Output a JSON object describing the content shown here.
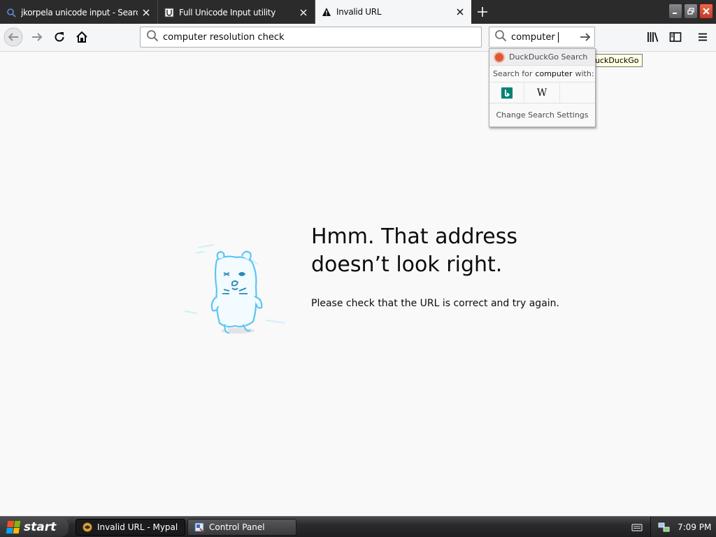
{
  "tabs": [
    {
      "label": "jkorpela unicode input - Search",
      "icon": "search-icon",
      "active": false
    },
    {
      "label": "Full Unicode Input utility",
      "icon": "unicode-icon",
      "active": false
    },
    {
      "label": "Invalid URL",
      "icon": "warning-icon",
      "active": true
    }
  ],
  "toolbar": {
    "url": "computer resolution check",
    "search_text": "computer"
  },
  "search_popup": {
    "engine_name": "DuckDuckGo Search",
    "search_for_prefix": "Search for",
    "search_term": "computer",
    "search_for_suffix": "with:",
    "engines": [
      "bing-icon",
      "wikipedia-icon",
      ""
    ],
    "settings_label": "Change Search Settings",
    "tooltip": "uckDuckGo"
  },
  "error": {
    "title": "Hmm. That address doesn’t look right.",
    "description": "Please check that the URL is correct and try again."
  },
  "taskbar": {
    "start_label": "start",
    "tasks": [
      {
        "label": "Invalid URL - Mypal",
        "pressed": true
      },
      {
        "label": "Control Panel",
        "pressed": false
      }
    ],
    "clock": "7:09 PM"
  },
  "colors": {
    "tabstrip": "#2b2b2c",
    "toolbar": "#f5f6f7",
    "page_bg": "#f9f9fa",
    "illustration": "#5ec5f0"
  }
}
